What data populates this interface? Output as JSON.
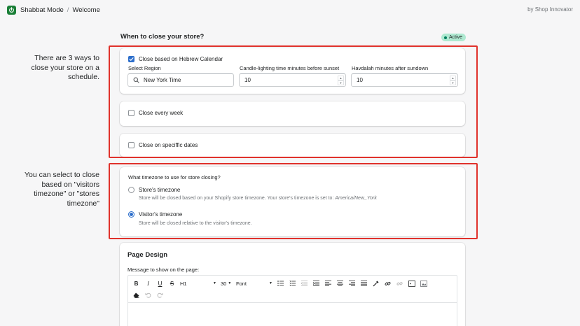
{
  "topbar": {
    "app_name": "Shabbat Mode",
    "separator": "/",
    "page": "Welcome",
    "by": "by Shop Innovator"
  },
  "main": {
    "heading": "When to close your store?",
    "status_badge": "Active"
  },
  "annotations": {
    "note1": "There are 3 ways to close your store on a schedule.",
    "note2": "You can select to close based on \"visitors timezone\" or \"stores timezone\""
  },
  "hebrew_calendar": {
    "checkbox_label": "Close based on Hebrew Calendar",
    "checked": true,
    "region_label": "Select Region",
    "region_value": "New York Time",
    "candle_label": "Candle-lighting time minutes before sunset",
    "candle_value": "10",
    "havdalah_label": "Havdalah minutes after sundown",
    "havdalah_value": "10"
  },
  "weekly": {
    "checkbox_label": "Close every week",
    "checked": false
  },
  "specific_dates": {
    "checkbox_label": "Close on speciffic dates",
    "checked": false
  },
  "timezone": {
    "question": "What timezone to use for store closing?",
    "options": [
      {
        "label": "Store's timezone",
        "help": "Store will be closed based on your Shopify store timezone. Your store's timezone is set to: ",
        "help_value": "America/New_York",
        "selected": false
      },
      {
        "label": "Visitor's timezone",
        "help": "Store will be closed relative to the visitor's timezone.",
        "selected": true
      }
    ]
  },
  "page_design": {
    "title": "Page Design",
    "message_label": "Message to show on the page:",
    "toolbar": {
      "bold": "B",
      "italic": "I",
      "underline": "U",
      "strike": "S",
      "heading_value": "H1",
      "font_size_value": "30",
      "font_value": "Font"
    }
  },
  "colors": {
    "accent": "#2c6ecb",
    "badge_bg": "#aee9d1",
    "annotation_red": "#e0322c",
    "logo_green": "#1a7f37"
  }
}
